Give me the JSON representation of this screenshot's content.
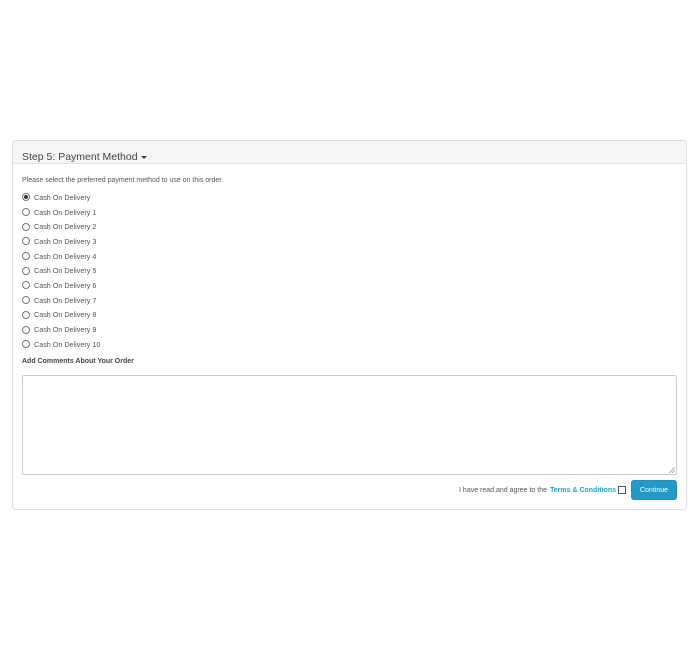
{
  "panel": {
    "title": "Step 5: Payment Method"
  },
  "payment": {
    "intro": "Please select the preferred payment method to use on this order.",
    "selected_index": 0,
    "options": [
      "Cash On Delivery",
      "Cash On Delivery 1",
      "Cash On Delivery 2",
      "Cash On Delivery 3",
      "Cash On Delivery 4",
      "Cash On Delivery 5",
      "Cash On Delivery 6",
      "Cash On Delivery 7",
      "Cash On Delivery 8",
      "Cash On Delivery 9",
      "Cash On Delivery 10"
    ]
  },
  "comments": {
    "label": "Add Comments About Your Order",
    "value": ""
  },
  "agree": {
    "text": "I have read and agree to the",
    "link": "Terms & Conditions",
    "checked": false
  },
  "actions": {
    "continue_label": "Continue"
  },
  "colors": {
    "button": "#229ac8",
    "link": "#23a1d1"
  }
}
